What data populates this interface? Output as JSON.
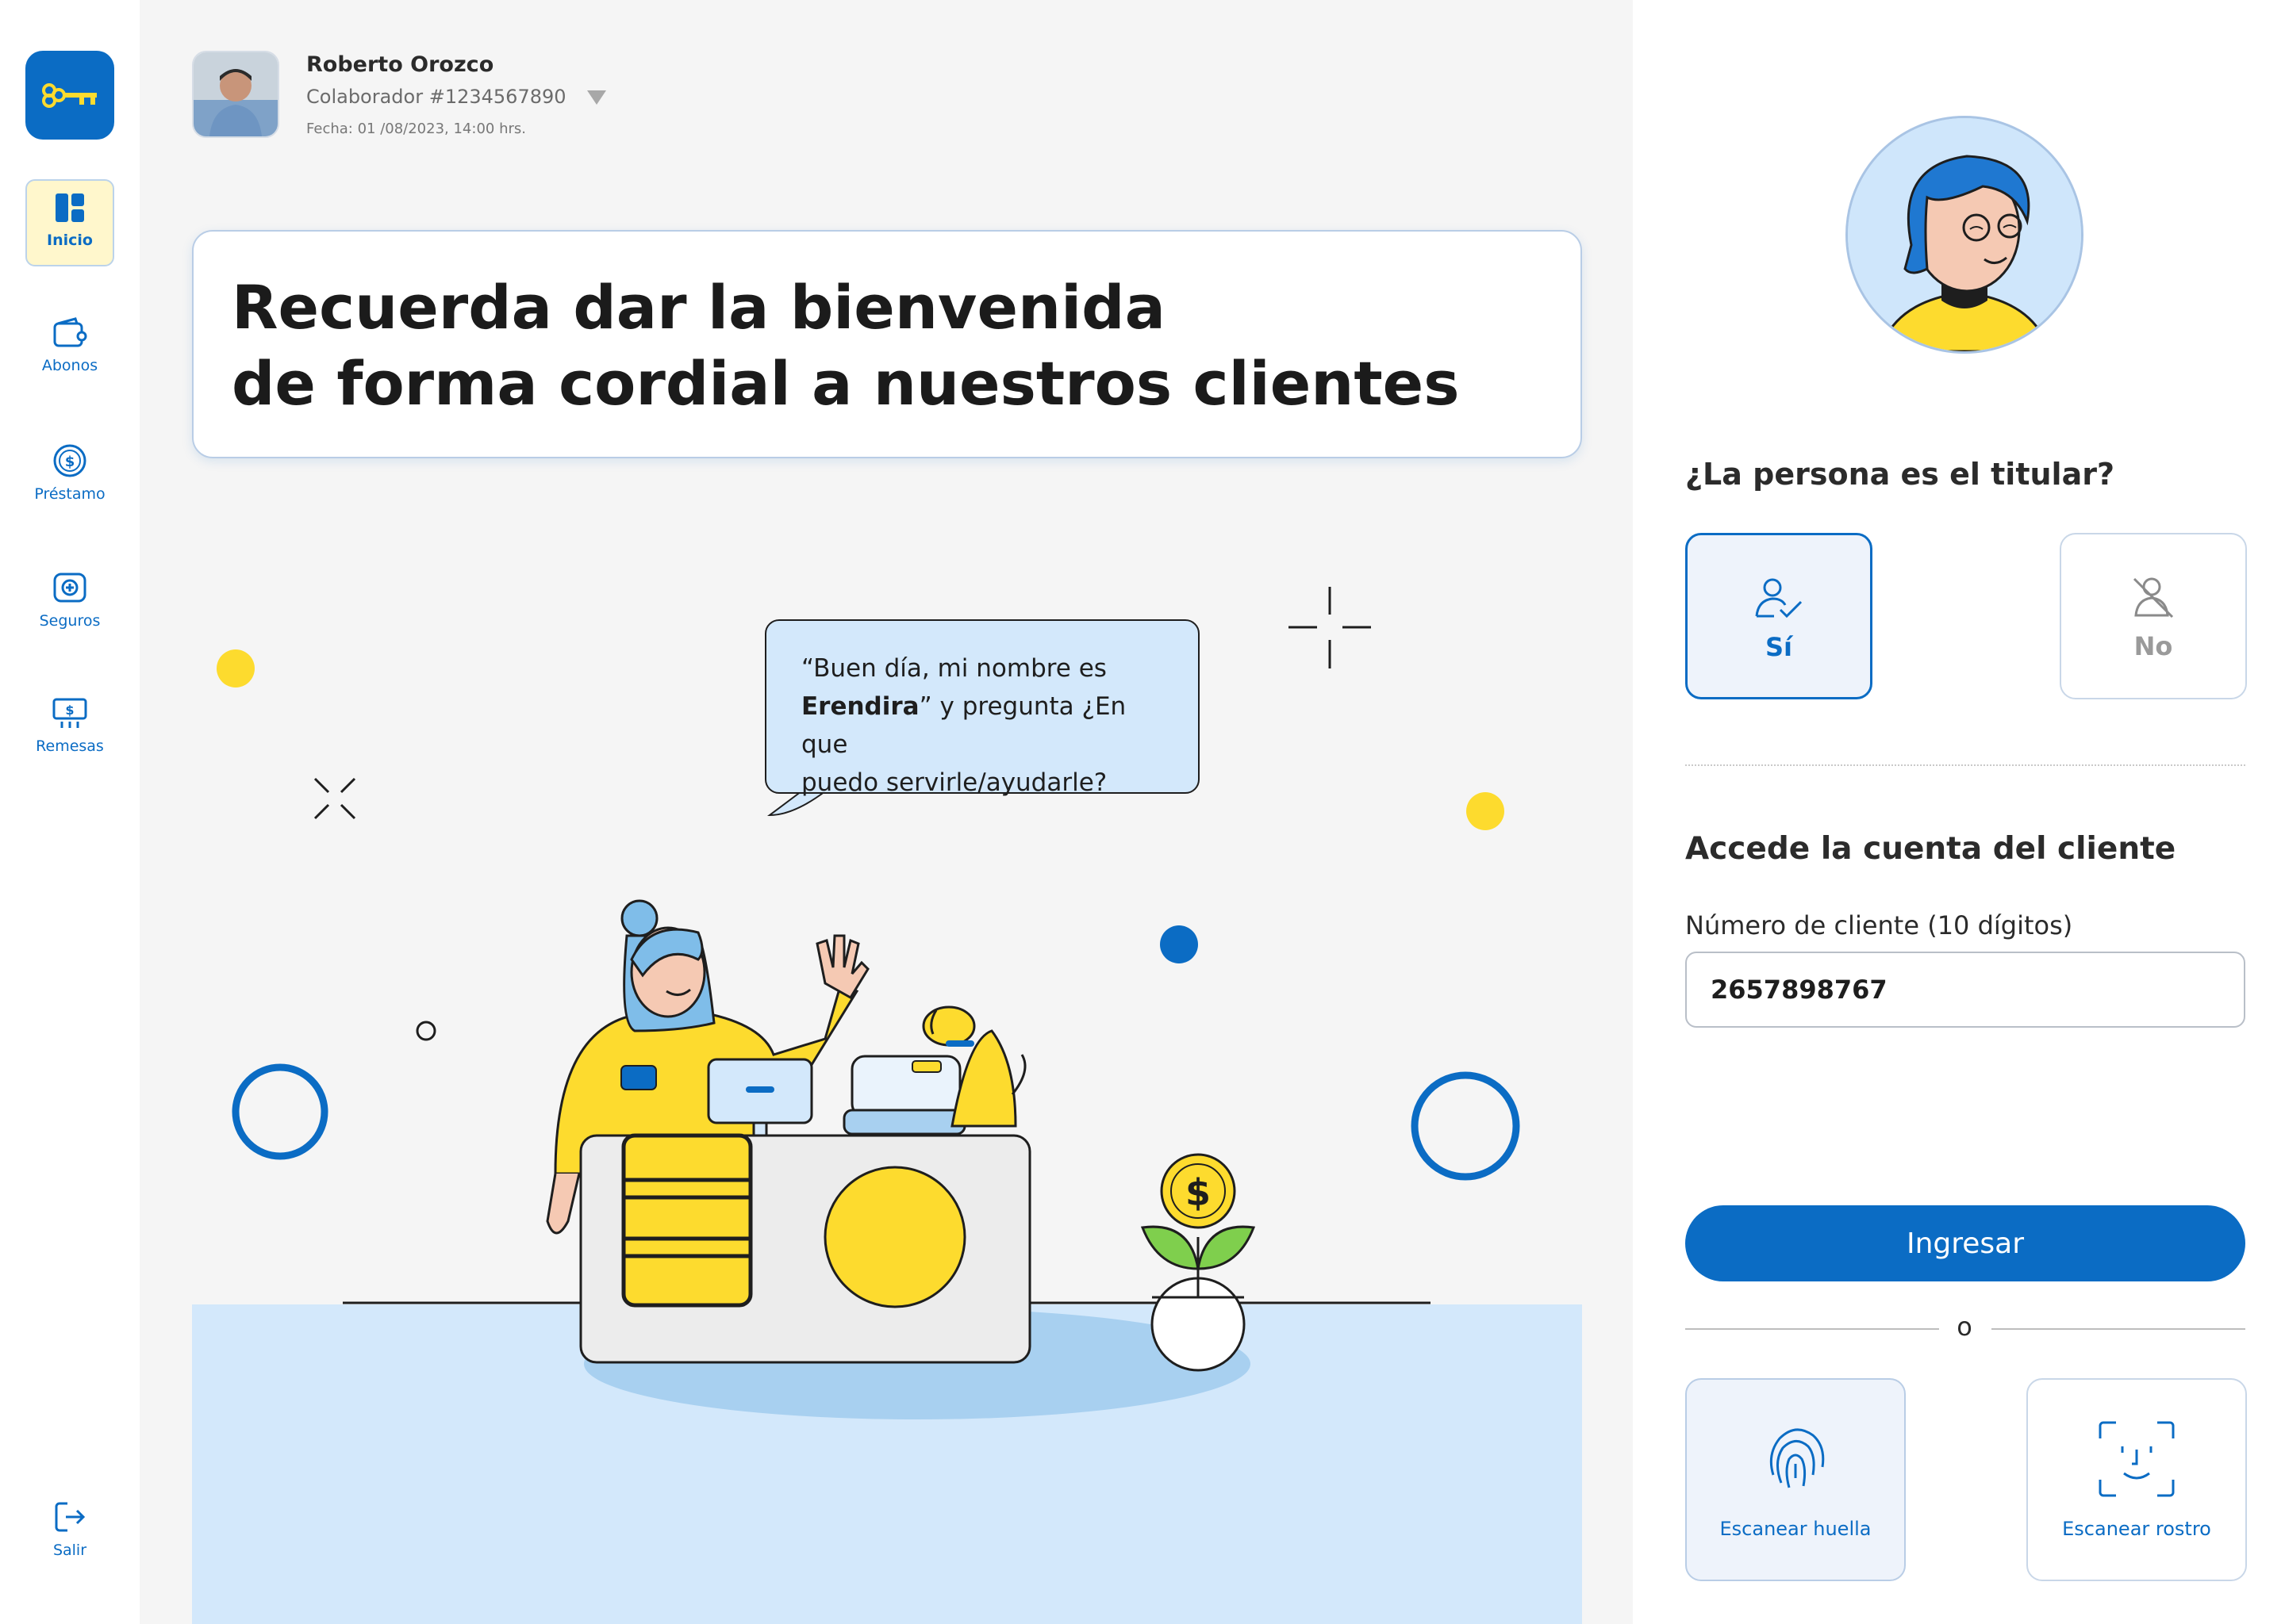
{
  "sidebar": {
    "items": [
      {
        "label": "Inicio",
        "icon": "dashboard-icon",
        "active": true
      },
      {
        "label": "Abonos",
        "icon": "wallet-icon"
      },
      {
        "label": "Préstamo",
        "icon": "dollar-coin-icon"
      },
      {
        "label": "Seguros",
        "icon": "insurance-icon"
      },
      {
        "label": "Remesas",
        "icon": "remittance-icon"
      }
    ],
    "logout_label": "Salir"
  },
  "user": {
    "name": "Roberto Orozco",
    "id": "Colaborador #1234567890",
    "date": "Fecha: 01 /08/2023, 14:00 hrs."
  },
  "banner": {
    "line1": "Recuerda dar la bienvenida",
    "line2": "de forma cordial a nuestros clientes"
  },
  "bubble": {
    "pre": "“Buen día, mi nombre es",
    "name": "Erendira",
    "post": "” y pregunta ¿En que",
    "line3": "puedo servirle/ayudarle?"
  },
  "panel": {
    "question": "¿La persona es el titular?",
    "yes_label": "Sí",
    "no_label": "No",
    "access_title": "Accede la cuenta del cliente",
    "field_label": "Número de cliente (10 dígitos)",
    "field_value": "2657898767",
    "submit_label": "Ingresar",
    "or_text": "o",
    "scan_finger_label": "Escanear huella",
    "scan_face_label": "Escanear rostro"
  },
  "colors": {
    "primary": "#0b6cc4",
    "accent_yellow": "#fddb2e",
    "light_blue": "#d3e8fb"
  }
}
